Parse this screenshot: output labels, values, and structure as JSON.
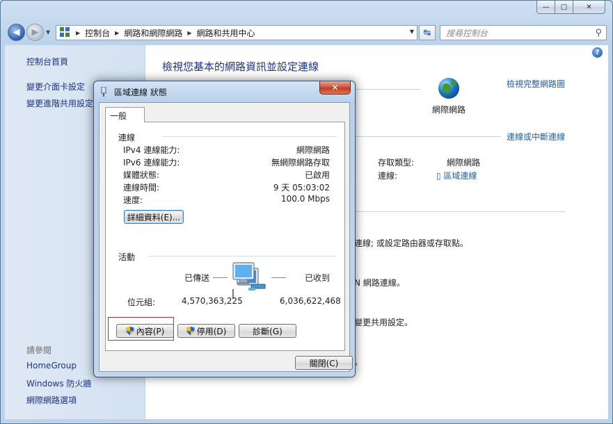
{
  "window": {
    "caption_buttons": {
      "minimize": "—",
      "maximize": "□",
      "close": "✕"
    }
  },
  "navbar": {
    "back_icon": "back-arrow-icon",
    "forward_icon": "forward-arrow-icon",
    "breadcrumbs": [
      "控制台",
      "網路和網際網路",
      "網路和共用中心"
    ],
    "search_placeholder": "搜尋控制台"
  },
  "sidebar": {
    "home": "控制台首頁",
    "tasks": [
      "變更介面卡設定",
      "變更進階共用設定"
    ],
    "see_also_heading": "請參閱",
    "see_also": [
      "HomeGroup",
      "Windows 防火牆",
      "網際網路選項"
    ]
  },
  "main": {
    "title": "檢視您基本的網路資訊並設定連線",
    "view_full_map": "檢視完整網路圖",
    "internet_label": "網際網路",
    "connect_disconnect": "連線或中斷連線",
    "access_type_label": "存取類型:",
    "access_type_value": "網際網路",
    "connections_label": "連線:",
    "connections_value": "區域連線",
    "partial_1": "連線; 或設定路由器或存取點。",
    "partial_2": "N 網路連線。",
    "partial_3": "變更共用設定。",
    "partial_4": "。"
  },
  "dialog": {
    "title": "區域連線 狀態",
    "close": "✕",
    "tab": "一般",
    "connection_group": "連線",
    "rows": [
      {
        "label": "IPv4 連線能力:",
        "value": "網際網路"
      },
      {
        "label": "IPv6 連線能力:",
        "value": "無網際網路存取"
      },
      {
        "label": "媒體狀態:",
        "value": "已啟用"
      },
      {
        "label": "連線時間:",
        "value": "9 天 05:03:02"
      },
      {
        "label": "速度:",
        "value": "100.0 Mbps"
      }
    ],
    "details_button": "詳細資料(E)...",
    "activity_group": "活動",
    "sent_label": "已傳送",
    "received_label": "已收到",
    "bytes_label": "位元組:",
    "bytes_sent": "4,570,363,225",
    "bytes_received": "6,036,622,468",
    "properties_button": "內容(P)",
    "disable_button": "停用(D)",
    "diagnose_button": "診斷(G)",
    "close_button": "關閉(C)"
  }
}
